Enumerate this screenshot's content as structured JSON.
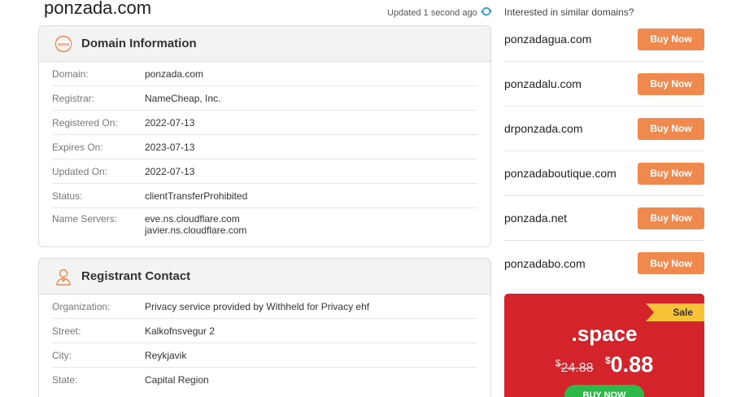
{
  "header": {
    "domain": "ponzada.com",
    "updated": "Updated 1 second ago"
  },
  "domain_info": {
    "title": "Domain Information",
    "rows": [
      {
        "label": "Domain:",
        "value": "ponzada.com"
      },
      {
        "label": "Registrar:",
        "value": "NameCheap, Inc."
      },
      {
        "label": "Registered On:",
        "value": "2022-07-13"
      },
      {
        "label": "Expires On:",
        "value": "2023-07-13"
      },
      {
        "label": "Updated On:",
        "value": "2022-07-13"
      },
      {
        "label": "Status:",
        "value": "clientTransferProhibited"
      }
    ],
    "name_servers_label": "Name Servers:",
    "name_servers": [
      "eve.ns.cloudflare.com",
      "javier.ns.cloudflare.com"
    ]
  },
  "registrant": {
    "title": "Registrant Contact",
    "rows": [
      {
        "label": "Organization:",
        "value": "Privacy service provided by Withheld for Privacy ehf"
      },
      {
        "label": "Street:",
        "value": "Kalkofnsvegur 2"
      },
      {
        "label": "City:",
        "value": "Reykjavik"
      },
      {
        "label": "State:",
        "value": "Capital Region"
      }
    ]
  },
  "sidebar": {
    "heading": "Interested in similar domains?",
    "buy_label": "Buy Now",
    "suggestions": [
      "ponzadagua.com",
      "ponzadalu.com",
      "drponzada.com",
      "ponzadaboutique.com",
      "ponzada.net",
      "ponzadabo.com"
    ]
  },
  "promo": {
    "badge": "Sale",
    "tld": ".space",
    "currency": "$",
    "old_price": "24.88",
    "new_price": "0.88",
    "cta": "BUY NOW",
    "bg_color": "#d4232b"
  },
  "colors": {
    "buy_button": "#f0894e",
    "refresh_icon": "#2a9fd8",
    "www_icon": "#f0894e"
  }
}
